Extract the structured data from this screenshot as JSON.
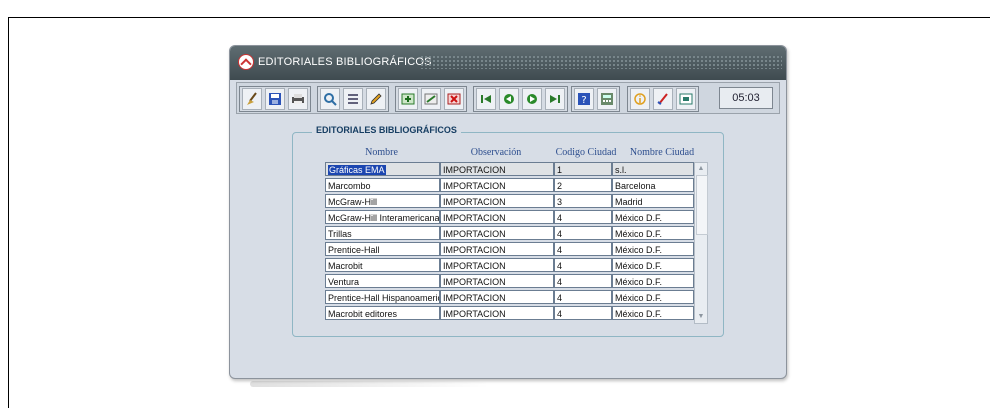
{
  "window": {
    "title": "EDITORIALES BIBLIOGRÁFICOS",
    "clock": "05:03"
  },
  "toolbar": {
    "icons": [
      "broom-icon",
      "save-icon",
      "print-icon",
      "search-icon",
      "list-icon",
      "edit-icon",
      "insert-record-icon",
      "duplicate-record-icon",
      "delete-record-icon",
      "first-record-icon",
      "previous-record-icon",
      "next-record-icon",
      "last-record-icon",
      "help-icon",
      "calculator-icon",
      "info-icon",
      "check-icon",
      "exit-icon"
    ]
  },
  "block": {
    "title": "EDITORIALES BIBLIOGRÁFICOS",
    "columns": [
      "Nombre",
      "Observación",
      "Codigo Ciudad",
      "Nombre Ciudad"
    ],
    "rows": [
      {
        "nombre": "Gráficas EMA",
        "observacion": "IMPORTACION",
        "codigo": "1",
        "ciudad": "s.l."
      },
      {
        "nombre": "Marcombo",
        "observacion": "IMPORTACION",
        "codigo": "2",
        "ciudad": "Barcelona"
      },
      {
        "nombre": "McGraw-Hill",
        "observacion": "IMPORTACION",
        "codigo": "3",
        "ciudad": "Madrid"
      },
      {
        "nombre": "McGraw-Hill Interamericana",
        "observacion": "IMPORTACION",
        "codigo": "4",
        "ciudad": "México D.F."
      },
      {
        "nombre": "Trillas",
        "observacion": "IMPORTACION",
        "codigo": "4",
        "ciudad": "México D.F."
      },
      {
        "nombre": "Prentice-Hall",
        "observacion": "IMPORTACION",
        "codigo": "4",
        "ciudad": "México D.F."
      },
      {
        "nombre": "Macrobit",
        "observacion": "IMPORTACION",
        "codigo": "4",
        "ciudad": "México D.F."
      },
      {
        "nombre": "Ventura",
        "observacion": "IMPORTACION",
        "codigo": "4",
        "ciudad": "México D.F."
      },
      {
        "nombre": "Prentice-Hall Hispanoamericana",
        "observacion": "IMPORTACION",
        "codigo": "4",
        "ciudad": "México D.F."
      },
      {
        "nombre": "Macrobit editores",
        "observacion": "IMPORTACION",
        "codigo": "4",
        "ciudad": "México D.F."
      }
    ]
  },
  "colors": {
    "titlebar": "#4a575c",
    "window_bg": "#d7dde6",
    "selection": "#1c46b0",
    "header_text": "#2d4e8e"
  }
}
